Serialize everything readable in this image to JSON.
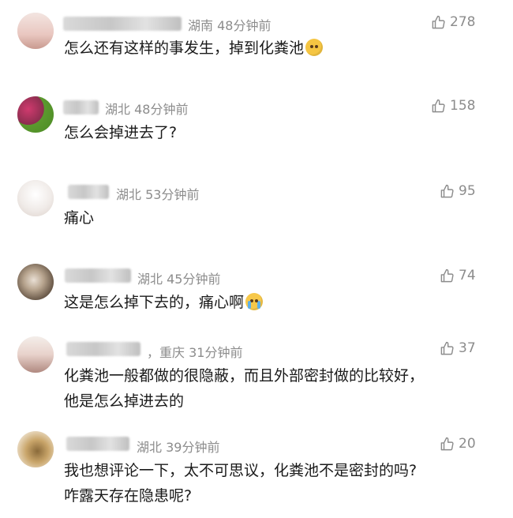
{
  "comments": [
    {
      "location": "湖南",
      "time": "48分钟前",
      "likes": "278",
      "text": "怎么还有这样的事发生，掉到化粪池",
      "emoji": "thinking-face",
      "avatar_color": "#e8c9c4"
    },
    {
      "location": "湖北",
      "time": "48分钟前",
      "likes": "158",
      "text": "怎么会掉进去了?",
      "avatar_color": "#8b2e4f"
    },
    {
      "location": "湖北",
      "time": "53分钟前",
      "likes": "95",
      "text": "痛心",
      "avatar_color": "#f0ebe8"
    },
    {
      "location": "湖北",
      "time": "45分钟前",
      "likes": "74",
      "text": "这是怎么掉下去的，痛心啊",
      "emoji": "crying-face",
      "avatar_color": "#6b5a4a"
    },
    {
      "location": "，重庆",
      "time": "31分钟前",
      "likes": "37",
      "text_lines": [
        "化粪池一般都做的很隐蔽，而且外部密封做的比较好，",
        "他是怎么掉进去的"
      ],
      "avatar_color": "#d9b8b0"
    },
    {
      "location": "湖北",
      "time": "39分钟前",
      "likes": "20",
      "text_lines": [
        "我也想评论一下，太不可思议，化粪池不是密封的吗?",
        "咋露天存在隐患呢?"
      ],
      "avatar_color": "#c9a56a"
    }
  ],
  "colors": {
    "meta": "#8c8c8c",
    "text": "#1a1a1a",
    "background": "#ffffff"
  },
  "icons": {
    "like": "thumbs-up-icon"
  }
}
